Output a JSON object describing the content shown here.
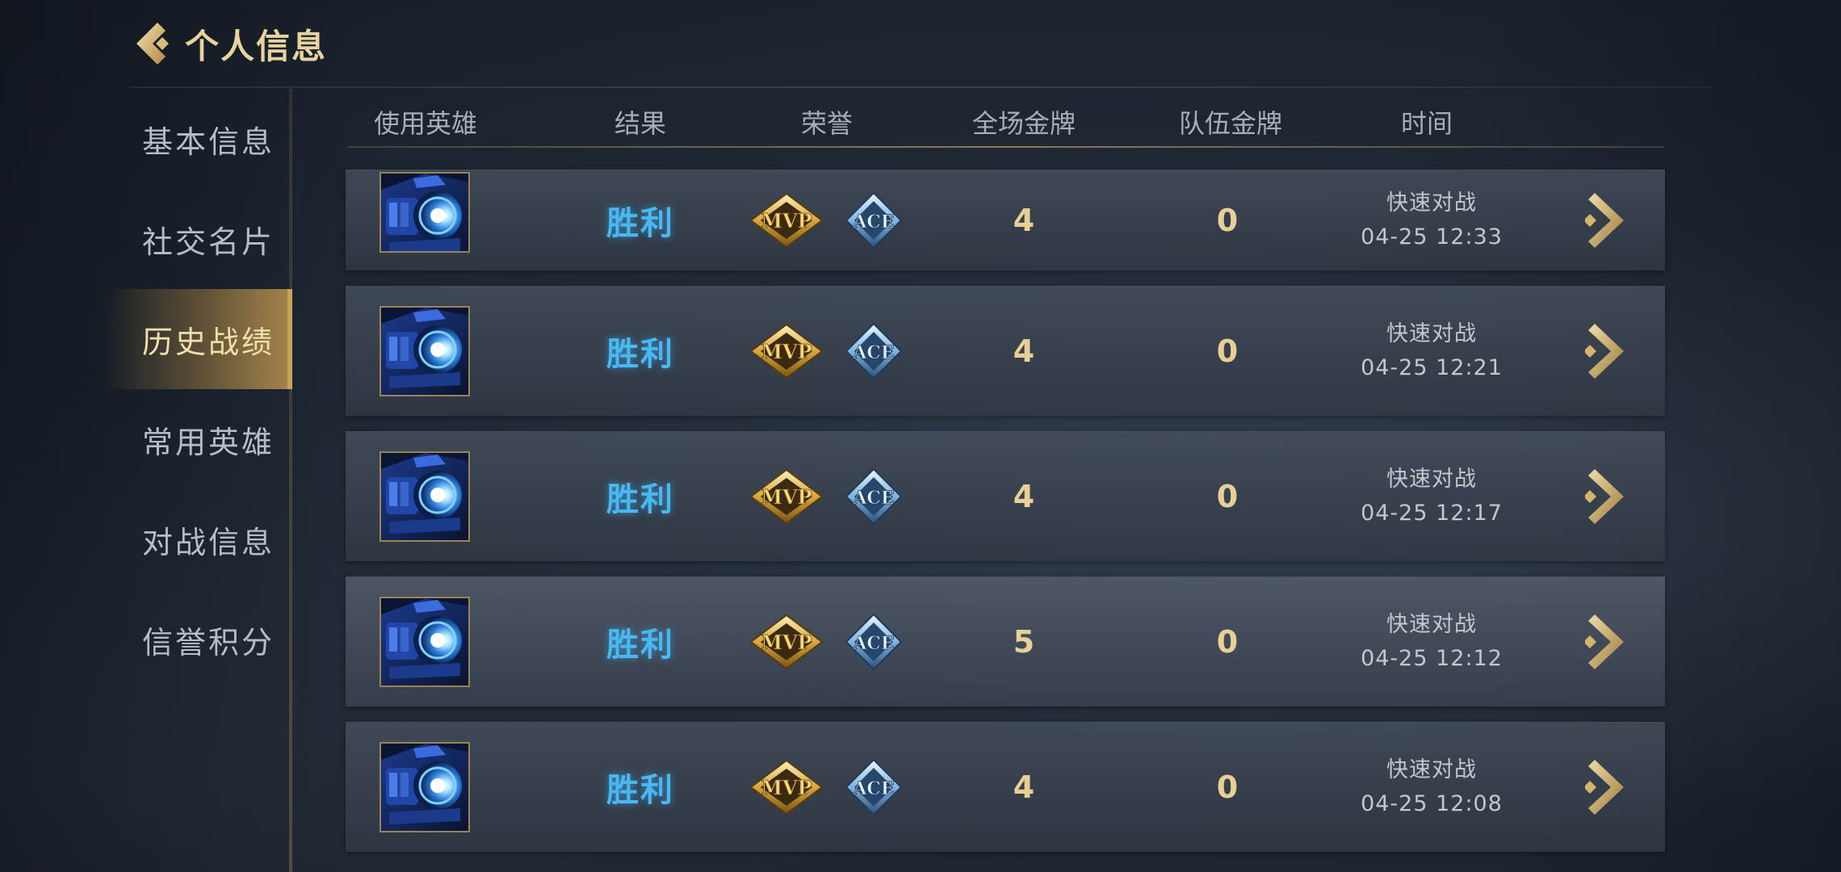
{
  "header": {
    "title": "个人信息",
    "back_icon": "gold-chevron-left-icon"
  },
  "sidebar": {
    "items": [
      {
        "label": "基本信息",
        "active": false
      },
      {
        "label": "社交名片",
        "active": false
      },
      {
        "label": "历史战绩",
        "active": true
      },
      {
        "label": "常用英雄",
        "active": false
      },
      {
        "label": "对战信息",
        "active": false
      },
      {
        "label": "信誉积分",
        "active": false
      }
    ]
  },
  "table": {
    "columns": [
      "使用英雄",
      "结果",
      "荣誉",
      "全场金牌",
      "队伍金牌",
      "时间"
    ],
    "rows": [
      {
        "hero_icon": "blue-mech-hero-portrait",
        "result": "胜利",
        "honors": [
          "MVP",
          "ACE"
        ],
        "match_gold": "4",
        "team_gold": "0",
        "mode": "快速对战",
        "time": "04-25 12:33"
      },
      {
        "hero_icon": "blue-mech-hero-portrait",
        "result": "胜利",
        "honors": [
          "MVP",
          "ACE"
        ],
        "match_gold": "4",
        "team_gold": "0",
        "mode": "快速对战",
        "time": "04-25 12:21"
      },
      {
        "hero_icon": "blue-mech-hero-portrait",
        "result": "胜利",
        "honors": [
          "MVP",
          "ACE"
        ],
        "match_gold": "4",
        "team_gold": "0",
        "mode": "快速对战",
        "time": "04-25 12:17"
      },
      {
        "hero_icon": "blue-mech-hero-portrait",
        "result": "胜利",
        "honors": [
          "MVP",
          "ACE"
        ],
        "match_gold": "5",
        "team_gold": "0",
        "mode": "快速对战",
        "time": "04-25 12:12"
      },
      {
        "hero_icon": "blue-mech-hero-portrait",
        "result": "胜利",
        "honors": [
          "MVP",
          "ACE"
        ],
        "match_gold": "4",
        "team_gold": "0",
        "mode": "快速对战",
        "time": "04-25 12:08"
      }
    ]
  },
  "colors": {
    "gold": "#e7cf95",
    "win_blue": "#49b8f0",
    "active_tab": "#c9a259"
  }
}
